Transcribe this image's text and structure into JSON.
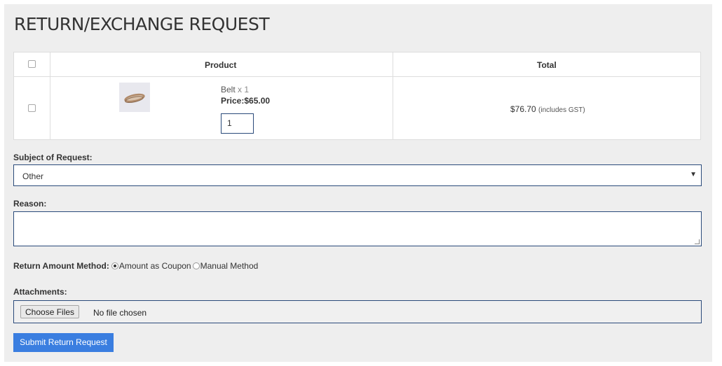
{
  "page": {
    "title": "RETURN/EXCHANGE REQUEST"
  },
  "table": {
    "headers": {
      "product": "Product",
      "total": "Total"
    },
    "rows": [
      {
        "name": "Belt",
        "qty_label": "x 1",
        "price": "Price:$65.00",
        "qty_value": "1",
        "total": "$76.70",
        "total_note": "(includes GST)"
      }
    ]
  },
  "subject": {
    "label": "Subject of Request:",
    "selected": "Other"
  },
  "reason": {
    "label": "Reason:",
    "value": ""
  },
  "return_method": {
    "label": "Return Amount Method:",
    "options": [
      {
        "label": "Amount as Coupon",
        "checked": true
      },
      {
        "label": "Manual Method",
        "checked": false
      }
    ]
  },
  "attachments": {
    "label": "Attachments:",
    "button": "Choose Files",
    "status": "No file chosen"
  },
  "submit_label": "Submit Return Request",
  "icons": {
    "select_arrow": "dropdown-caret-icon",
    "product_image": "belt-thumbnail"
  }
}
